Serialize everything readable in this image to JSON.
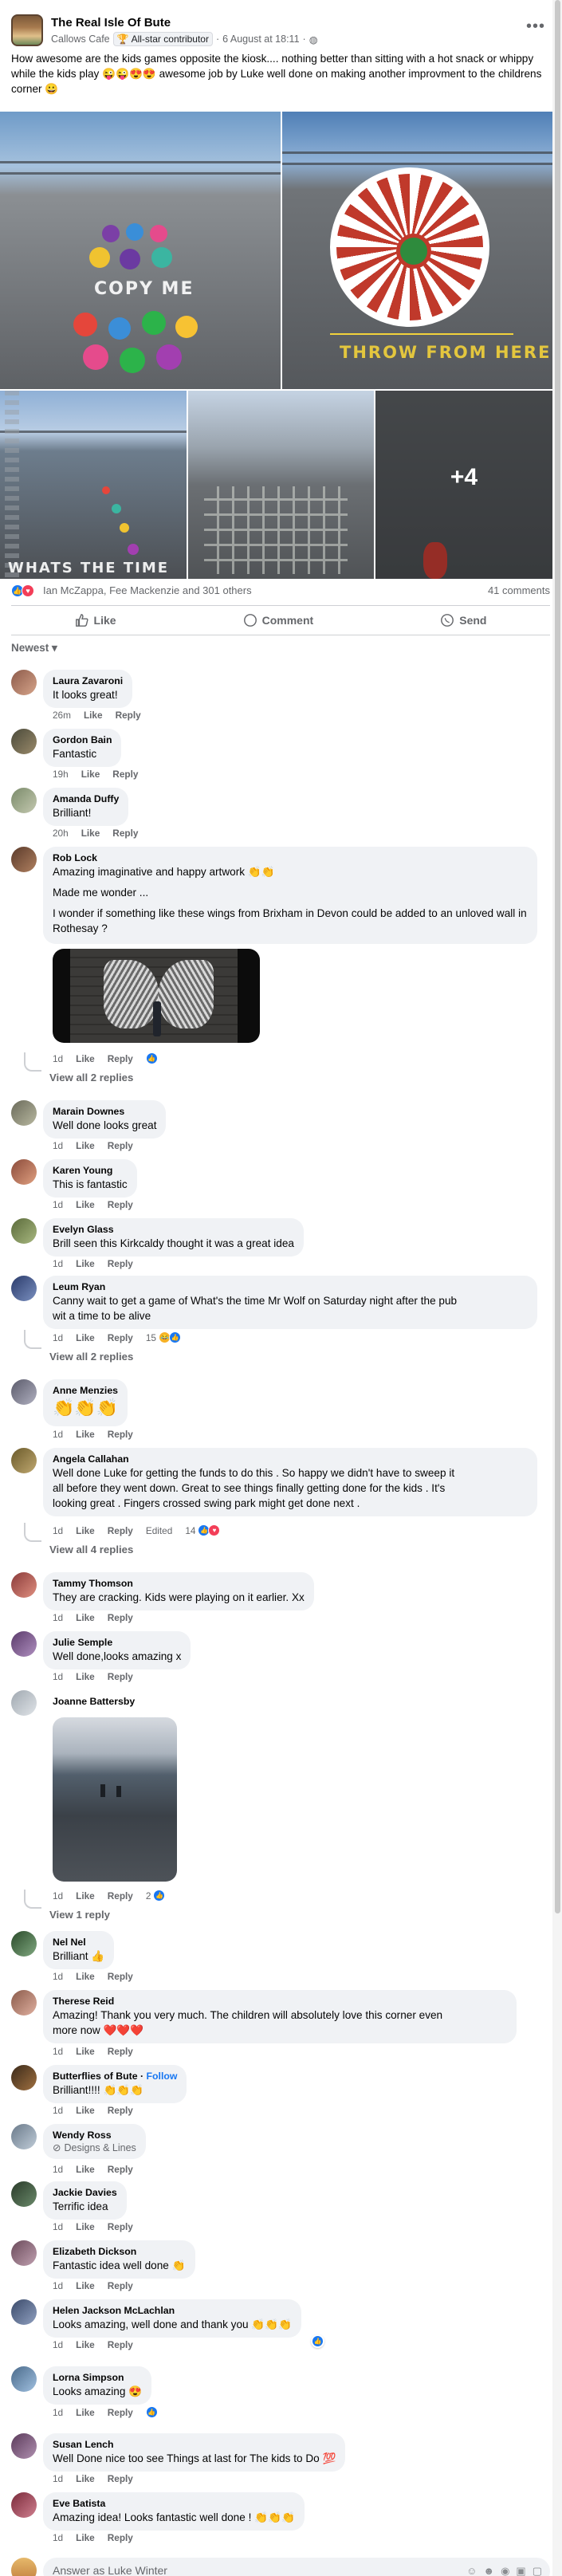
{
  "post": {
    "group_name": "The Real Isle Of Bute",
    "author": "Callows Cafe",
    "badge": "All-star contributor",
    "separator": "·",
    "date": "6 August at 18:11",
    "more_icon": "more-horizontal-icon",
    "text": "How awesome are the kids games opposite the kiosk.... nothing better than sitting with a hot snack or whippy while the kids play 😜😜😍😍 awesome job by Luke well done on making another improvment to the childrens corner 😀",
    "photos": [
      {
        "painted_text": "COPY ME"
      },
      {
        "painted_text": "THROW FROM HERE"
      },
      {
        "painted_text": "WHATS THE TIME"
      },
      {
        "painted_text": ""
      },
      {
        "painted_text": "",
        "more_label": "+4"
      }
    ],
    "reactors": "Ian McZappa, Fee Mackenzie and 301 others",
    "comment_count": "41 comments",
    "actions": {
      "like": "Like",
      "comment": "Comment",
      "send": "Send"
    },
    "sort_label": "Newest"
  },
  "labels": {
    "like": "Like",
    "reply": "Reply",
    "edited": "Edited"
  },
  "comments": [
    {
      "name": "Laura Zavaroni",
      "text": "It looks great!",
      "time": "26m"
    },
    {
      "name": "Gordon Bain",
      "text": "Fantastic",
      "time": "19h"
    },
    {
      "name": "Amanda Duffy",
      "text": "Brilliant!",
      "time": "20h"
    },
    {
      "name": "Rob Lock",
      "text_lines": [
        "Amazing imaginative and happy artwork 👏👏",
        "Made me wonder ...",
        "I wonder if something like these wings from Brixham in Devon could be added to an unloved wall in Rothesay ?"
      ],
      "time": "1d",
      "view_replies": "View all 2 replies"
    },
    {
      "name": "Marain Downes",
      "text": "Well done looks great",
      "time": "1d"
    },
    {
      "name": "Karen Young",
      "text": "This is fantastic",
      "time": "1d"
    },
    {
      "name": "Evelyn Glass",
      "text": "Brill seen this Kirkcaldy thought it was a great idea",
      "time": "1d"
    },
    {
      "name": "Leum Ryan",
      "text_lines": [
        "Canny wait to get a game of What's the time Mr Wolf on Saturday night after the pub",
        "wit a time to be alive"
      ],
      "time": "1d",
      "react_count": "15",
      "view_replies": "View all 2 replies"
    },
    {
      "name": "Anne Menzies",
      "text": "👏👏👏",
      "time": "1d"
    },
    {
      "name": "Angela Callahan",
      "text_lines": [
        "Well done Luke for getting the funds to do this . So happy we didn't have to sweep it",
        "all before they went down. Great to see things finally getting done for the kids . It's",
        "looking great . Fingers crossed swing park might get done next ."
      ],
      "time": "1d",
      "react_count": "14",
      "view_replies": "View all 4 replies"
    },
    {
      "name": "Tammy Thomson",
      "text": "They are cracking. Kids were playing on it earlier. Xx",
      "time": "1d"
    },
    {
      "name": "Julie Semple",
      "text": "Well done,looks amazing x",
      "time": "1d"
    },
    {
      "name": "Joanne Battersby",
      "text": "",
      "time": "1d",
      "react_count": "2",
      "view_replies": "View 1 reply"
    },
    {
      "name": "Nel Nel",
      "text": "Brilliant 👍",
      "time": "1d"
    },
    {
      "name": "Therese Reid",
      "text_lines": [
        "Amazing! Thank you very much. The children will absolutely love this corner even",
        "more now ❤️❤️❤️"
      ],
      "time": "1d"
    },
    {
      "name": "Butterflies of Bute",
      "follow": "Follow",
      "text": "Brilliant!!!! 👏👏👏",
      "time": "1d"
    },
    {
      "name": "Wendy Ross",
      "subtitle": "Designs & Lines",
      "text": "",
      "time": "1d"
    },
    {
      "name": "Jackie Davies",
      "text": "Terrific idea",
      "time": "1d"
    },
    {
      "name": "Elizabeth Dickson",
      "text": "Fantastic idea well done 👏",
      "time": "1d"
    },
    {
      "name": "Helen Jackson McLachlan",
      "text": "Looks amazing, well done and thank you 👏👏👏",
      "time": "1d"
    },
    {
      "name": "Lorna Simpson",
      "text": "Looks amazing 😍",
      "time": "1d"
    },
    {
      "name": "Susan Lench",
      "text": "Well Done nice too see Things at last for The kids to Do 💯",
      "time": "1d"
    },
    {
      "name": "Eve Batista",
      "text": "Amazing idea! Looks fantastic well done ! 👏👏👏",
      "time": "1d"
    }
  ],
  "composer": {
    "placeholder": "Answer as Luke Winter"
  }
}
